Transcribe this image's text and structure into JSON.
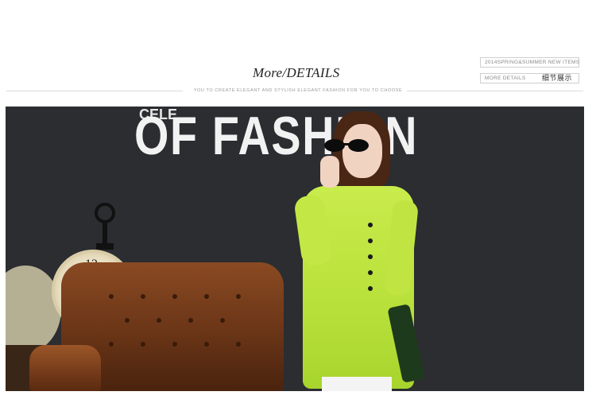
{
  "header": {
    "title_prefix": "More",
    "title_main": "/DETAILS",
    "subtitle": "YOU TO CREATE ELEGANT AND STYLISH ELEGANT FASHION FOR YOU TO CHOOSE",
    "tag_season": "2014SPRING&SUMMER NEW ITEMS",
    "tag_more": "MORE DETAILS",
    "tag_cn": "细节展示"
  },
  "photo": {
    "wall_text": "OF FASHION",
    "wall_text_top": "CELE",
    "clock_number": "12",
    "colors": {
      "wall": "#2b2d31",
      "shirt": "#b8e03a",
      "leather": "#7a3f1c"
    }
  }
}
